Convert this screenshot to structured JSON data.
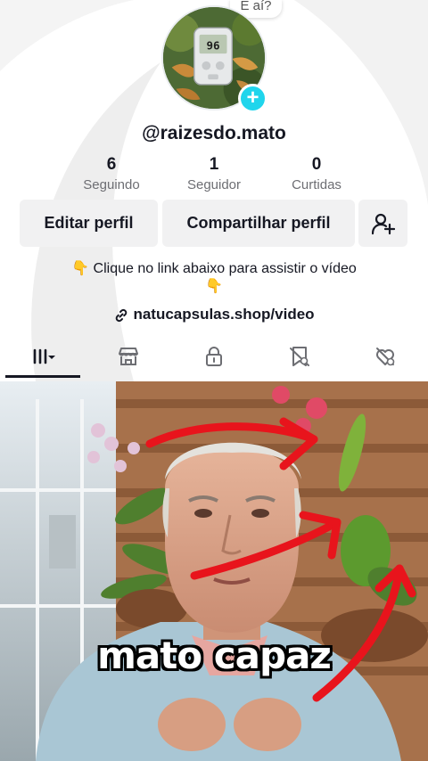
{
  "bubble": {
    "text": "E aí?"
  },
  "avatar": {
    "meter_reading": "96"
  },
  "profile": {
    "username": "@raizesdo.mato"
  },
  "stats": [
    {
      "value": "6",
      "label": "Seguindo"
    },
    {
      "value": "1",
      "label": "Seguidor"
    },
    {
      "value": "0",
      "label": "Curtidas"
    }
  ],
  "buttons": {
    "edit": "Editar perfil",
    "share": "Compartilhar perfil"
  },
  "bio": {
    "line1": "👇 Clique no link abaixo para assistir o vídeo",
    "line2": "👇"
  },
  "link": {
    "text": "natucapsulas.shop/video"
  },
  "tabs": [
    {
      "icon": "videos-grid-icon",
      "active": true
    },
    {
      "icon": "shop-icon",
      "active": false
    },
    {
      "icon": "lock-icon",
      "active": false
    },
    {
      "icon": "saved-icon",
      "active": false
    },
    {
      "icon": "liked-icon",
      "active": false
    }
  ],
  "video": {
    "caption": "mato capaz",
    "arrow_color": "#e8141c"
  },
  "colors": {
    "accent": "#20d5ec",
    "text": "#161823",
    "secondary_text": "#6d6e73",
    "button_bg": "#f1f1f2"
  }
}
